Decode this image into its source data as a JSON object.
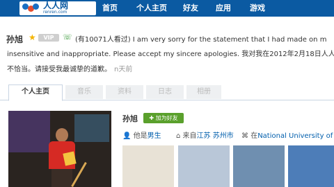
{
  "logo": {
    "text": "人人网",
    "sub": "renren.com"
  },
  "nav": [
    "首页",
    "个人主页",
    "好友",
    "应用",
    "游戏"
  ],
  "profile": {
    "name": "孙旭",
    "vip_label": "VIP",
    "status_line1": "(有10071人看过) I am very sorry for the statement that I had made on m",
    "status_line2": "insensitive and inappropriate. Please accept my sincere apologies. 我对我在2012年2月18日人人",
    "status_line3": "不恰当。请接受我最诚挚的道歉。",
    "status_time": "n天前"
  },
  "tabs": [
    "个人主页",
    "音乐",
    "资料",
    "日志",
    "相册"
  ],
  "info": {
    "name": "孙旭",
    "add_friend": "加为好友",
    "gender_prefix": "他是",
    "gender": "男生",
    "from_prefix": "来自",
    "from_province": "江苏",
    "from_city": "苏州市",
    "school_prefix": "在",
    "school": "National University of S"
  },
  "colors": {
    "topbar": "#0b5aa2",
    "link": "#005eac",
    "add_button": "#5aa02c"
  }
}
